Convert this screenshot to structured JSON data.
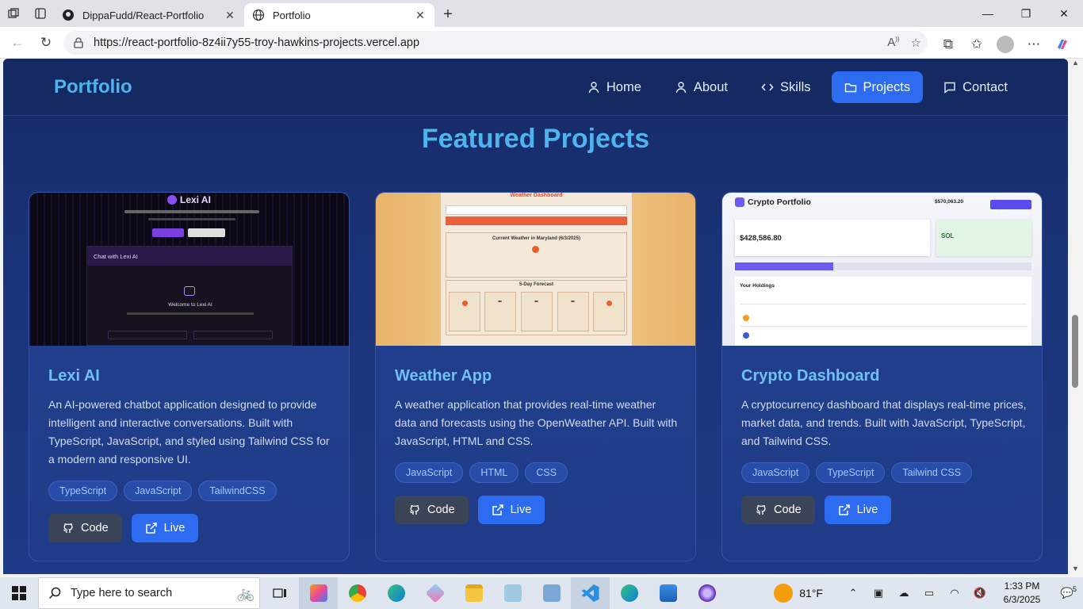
{
  "browser": {
    "tabs": [
      {
        "title": "DippaFudd/React-Portfolio",
        "active": false
      },
      {
        "title": "Portfolio",
        "active": true
      }
    ],
    "url": "https://react-portfolio-8z4ii7y55-troy-hawkins-projects.vercel.app"
  },
  "site": {
    "brand": "Portfolio",
    "nav": [
      {
        "label": "Home",
        "icon": "user-icon",
        "active": false
      },
      {
        "label": "About",
        "icon": "user-icon",
        "active": false
      },
      {
        "label": "Skills",
        "icon": "code-icon",
        "active": false
      },
      {
        "label": "Projects",
        "icon": "folder-icon",
        "active": true
      },
      {
        "label": "Contact",
        "icon": "message-icon",
        "active": false
      }
    ],
    "section_title": "Featured Projects",
    "projects": [
      {
        "title": "Lexi AI",
        "description": "An AI-powered chatbot application designed to provide intelligent and interactive conversations. Built with TypeScript, JavaScript, and styled using Tailwind CSS for a modern and responsive UI.",
        "tags": [
          "TypeScript",
          "JavaScript",
          "TailwindCSS"
        ],
        "code_label": "Code",
        "live_label": "Live",
        "preview": {
          "app_name": "Lexi AI",
          "chat_header": "Chat with Lexi AI",
          "welcome": "Welcome to Lexi AI"
        }
      },
      {
        "title": "Weather App",
        "description": "A weather application that provides real-time weather data and forecasts using the OpenWeather API. Built with JavaScript, HTML and CSS.",
        "tags": [
          "JavaScript",
          "HTML",
          "CSS"
        ],
        "code_label": "Code",
        "live_label": "Live",
        "preview": {
          "app_name": "Weather Dashboard",
          "current": "Current Weather in Maryland (6/3/2025)",
          "forecast": "5-Day Forecast"
        }
      },
      {
        "title": "Crypto Dashboard",
        "description": "A cryptocurrency dashboard that displays real-time prices, market data, and trends. Built with JavaScript, TypeScript, and Tailwind CSS.",
        "tags": [
          "JavaScript",
          "TypeScript",
          "Tailwind CSS"
        ],
        "code_label": "Code",
        "live_label": "Live",
        "preview": {
          "app_name": "Crypto Portfolio",
          "total": "$570,063.20",
          "portfolio_value": "$428,586.80",
          "best": "SOL",
          "holdings": "Your Holdings"
        }
      }
    ]
  },
  "taskbar": {
    "search_placeholder": "Type here to search",
    "weather": "81°F",
    "time": "1:33 PM",
    "date": "6/3/2025",
    "notification_count": "5"
  },
  "colors": {
    "accent": "#2d6cf0",
    "brand": "#4fb3ee",
    "page_bg": "#1b3378"
  }
}
